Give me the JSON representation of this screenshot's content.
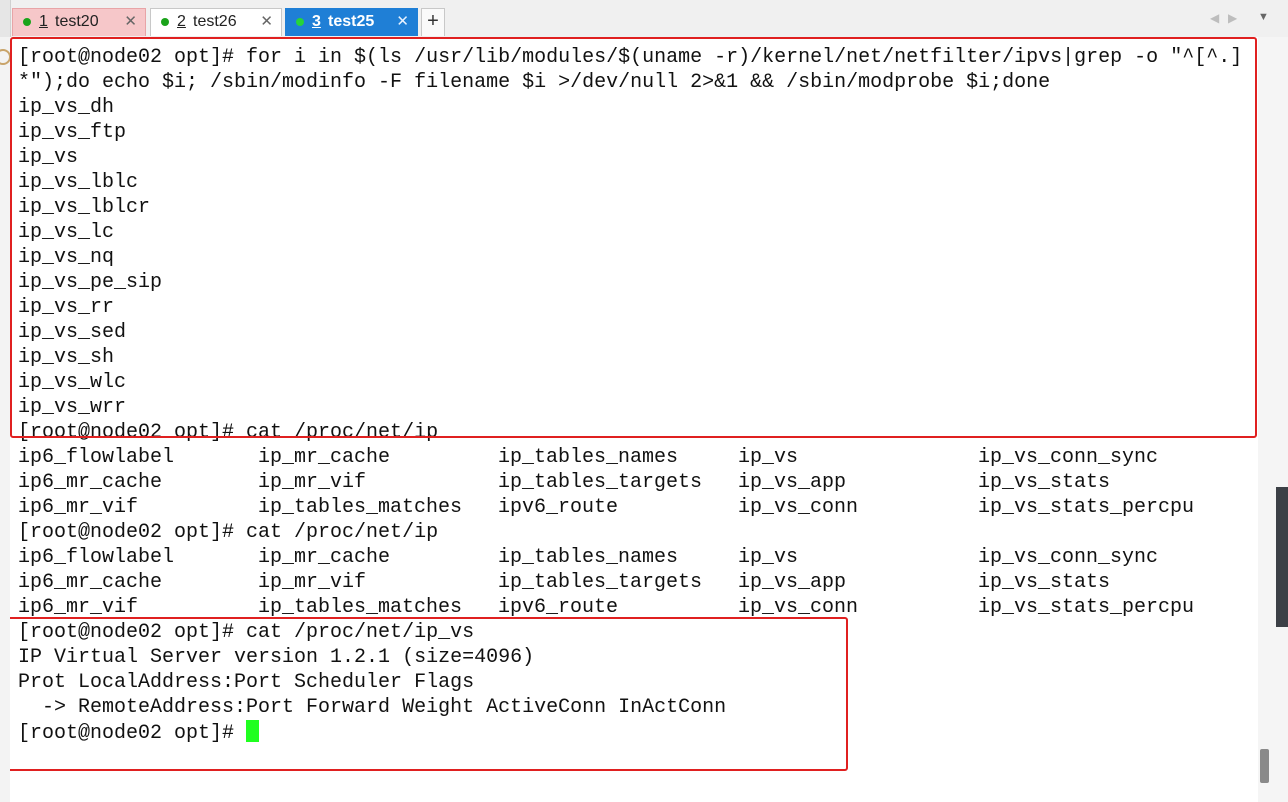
{
  "tabs": [
    {
      "num": "1",
      "name": "test20",
      "close": "✕"
    },
    {
      "num": "2",
      "name": "test26",
      "close": "✕"
    },
    {
      "num": "3",
      "name": "test25",
      "close": "✕"
    }
  ],
  "new_tab_label": "+",
  "terminal": {
    "lines": [
      "[root@node02 opt]# for i in $(ls /usr/lib/modules/$(uname -r)/kernel/net/netfilter/ipvs|grep -o \"^[^.]",
      "*\");do echo $i; /sbin/modinfo -F filename $i >/dev/null 2>&1 && /sbin/modprobe $i;done",
      "ip_vs_dh",
      "ip_vs_ftp",
      "ip_vs",
      "ip_vs_lblc",
      "ip_vs_lblcr",
      "ip_vs_lc",
      "ip_vs_nq",
      "ip_vs_pe_sip",
      "ip_vs_rr",
      "ip_vs_sed",
      "ip_vs_sh",
      "ip_vs_wlc",
      "ip_vs_wrr",
      "[root@node02 opt]# cat /proc/net/ip"
    ],
    "listing1": [
      [
        "ip6_flowlabel",
        "ip_mr_cache",
        "ip_tables_names",
        "ip_vs",
        "ip_vs_conn_sync"
      ],
      [
        "ip6_mr_cache",
        "ip_mr_vif",
        "ip_tables_targets",
        "ip_vs_app",
        "ip_vs_stats"
      ],
      [
        "ip6_mr_vif",
        "ip_tables_matches",
        "ipv6_route",
        "ip_vs_conn",
        "ip_vs_stats_percpu"
      ]
    ],
    "prompt2": "[root@node02 opt]# cat /proc/net/ip",
    "listing2": [
      [
        "ip6_flowlabel",
        "ip_mr_cache",
        "ip_tables_names",
        "ip_vs",
        "ip_vs_conn_sync"
      ],
      [
        "ip6_mr_cache",
        "ip_mr_vif",
        "ip_tables_targets",
        "ip_vs_app",
        "ip_vs_stats"
      ],
      [
        "ip6_mr_vif",
        "ip_tables_matches",
        "ipv6_route",
        "ip_vs_conn",
        "ip_vs_stats_percpu"
      ]
    ],
    "tail": [
      "[root@node02 opt]# cat /proc/net/ip_vs",
      "IP Virtual Server version 1.2.1 (size=4096)",
      "Prot LocalAddress:Port Scheduler Flags",
      "  -> RemoteAddress:Port Forward Weight ActiveConn InActConn"
    ],
    "final_prompt": "[root@node02 opt]# "
  },
  "colors": {
    "active_tab": "#1f7fd6",
    "tab1_bg": "#f6c7c9",
    "status_dot": "#1aa31a",
    "cursor": "#1fff1f",
    "annotation_box": "#e02020"
  },
  "icons": [
    "search-icon",
    "close-icon",
    "plus-icon",
    "chevron-left-icon",
    "chevron-right-icon",
    "chevron-down-icon"
  ]
}
